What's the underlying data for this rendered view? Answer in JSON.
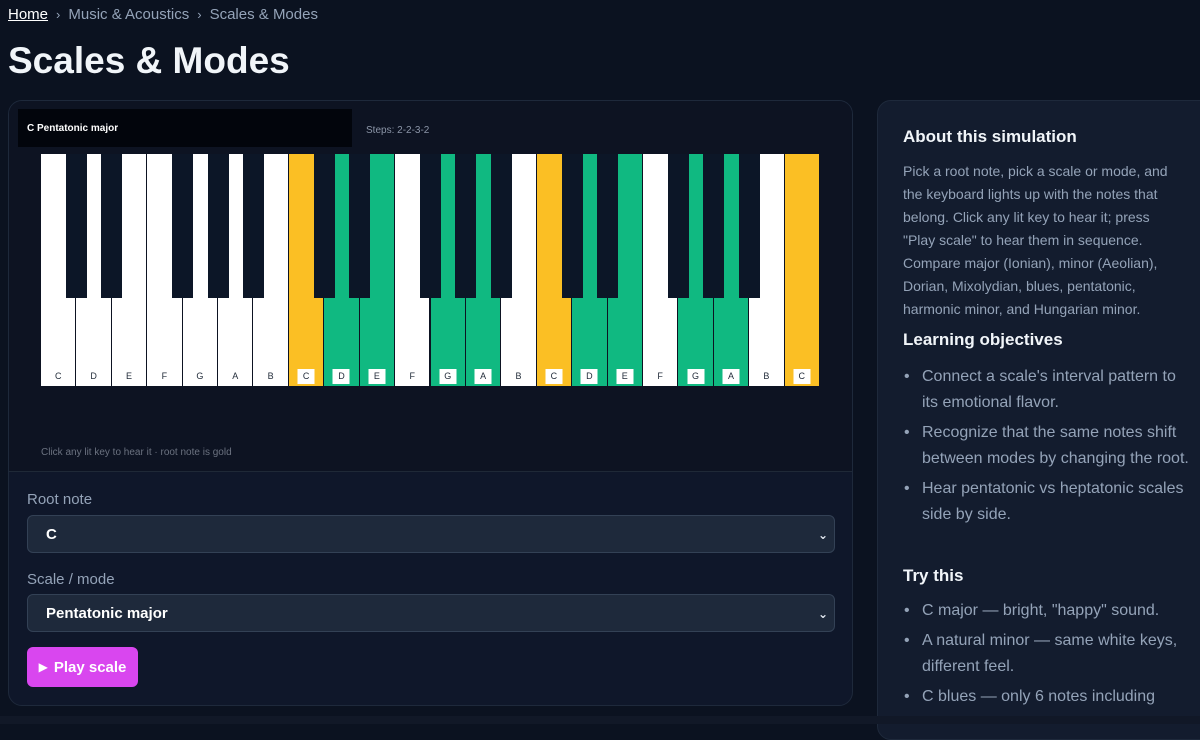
{
  "breadcrumb": {
    "home": "Home",
    "section": "Music & Acoustics",
    "current": "Scales & Modes"
  },
  "page_title": "Scales & Modes",
  "simulation": {
    "scale_label": "C  Pentatonic major",
    "steps_label": "Steps: 2-2-3-2",
    "hint": "Click any lit key to hear it · root note is gold",
    "colors": {
      "root": "#fbbf24",
      "in_scale": "#10b981",
      "off": "#ffffff",
      "black_off": "#0c1627"
    },
    "white_keys": [
      {
        "note": "C",
        "state": "off"
      },
      {
        "note": "D",
        "state": "off"
      },
      {
        "note": "E",
        "state": "off"
      },
      {
        "note": "F",
        "state": "off"
      },
      {
        "note": "G",
        "state": "off"
      },
      {
        "note": "A",
        "state": "off"
      },
      {
        "note": "B",
        "state": "off"
      },
      {
        "note": "C",
        "state": "root"
      },
      {
        "note": "D",
        "state": "in"
      },
      {
        "note": "E",
        "state": "in"
      },
      {
        "note": "F",
        "state": "off"
      },
      {
        "note": "G",
        "state": "in"
      },
      {
        "note": "A",
        "state": "in"
      },
      {
        "note": "B",
        "state": "off"
      },
      {
        "note": "C",
        "state": "root"
      },
      {
        "note": "D",
        "state": "in"
      },
      {
        "note": "E",
        "state": "in"
      },
      {
        "note": "F",
        "state": "off"
      },
      {
        "note": "G",
        "state": "in"
      },
      {
        "note": "A",
        "state": "in"
      },
      {
        "note": "B",
        "state": "off"
      },
      {
        "note": "C",
        "state": "root"
      }
    ]
  },
  "controls": {
    "root_label": "Root note",
    "root_value": "C",
    "scale_label": "Scale / mode",
    "scale_value": "Pentatonic major",
    "play_label": "Play scale",
    "chevron_icon": "chevron-down-icon",
    "play_icon": "play-icon"
  },
  "sidebar": {
    "about_title": "About this simulation",
    "about_text": "Pick a root note, pick a scale or mode, and the keyboard lights up with the notes that belong. Click any lit key to hear it; press \"Play scale\" to hear them in sequence. Compare major (Ionian), minor (Aeolian), Dorian, Mixolydian, blues, pentatonic, harmonic minor, and Hungarian minor.",
    "objectives_title": "Learning objectives",
    "objectives": [
      "Connect a scale's interval pattern to its emotional flavor.",
      "Recognize that the same notes shift between modes by changing the root.",
      "Hear pentatonic vs heptatonic scales side by side."
    ],
    "try_title": "Try this",
    "try_items": [
      "C major — bright, \"happy\" sound.",
      "A natural minor — same white keys, different feel.",
      "C blues — only 6 notes including"
    ]
  }
}
